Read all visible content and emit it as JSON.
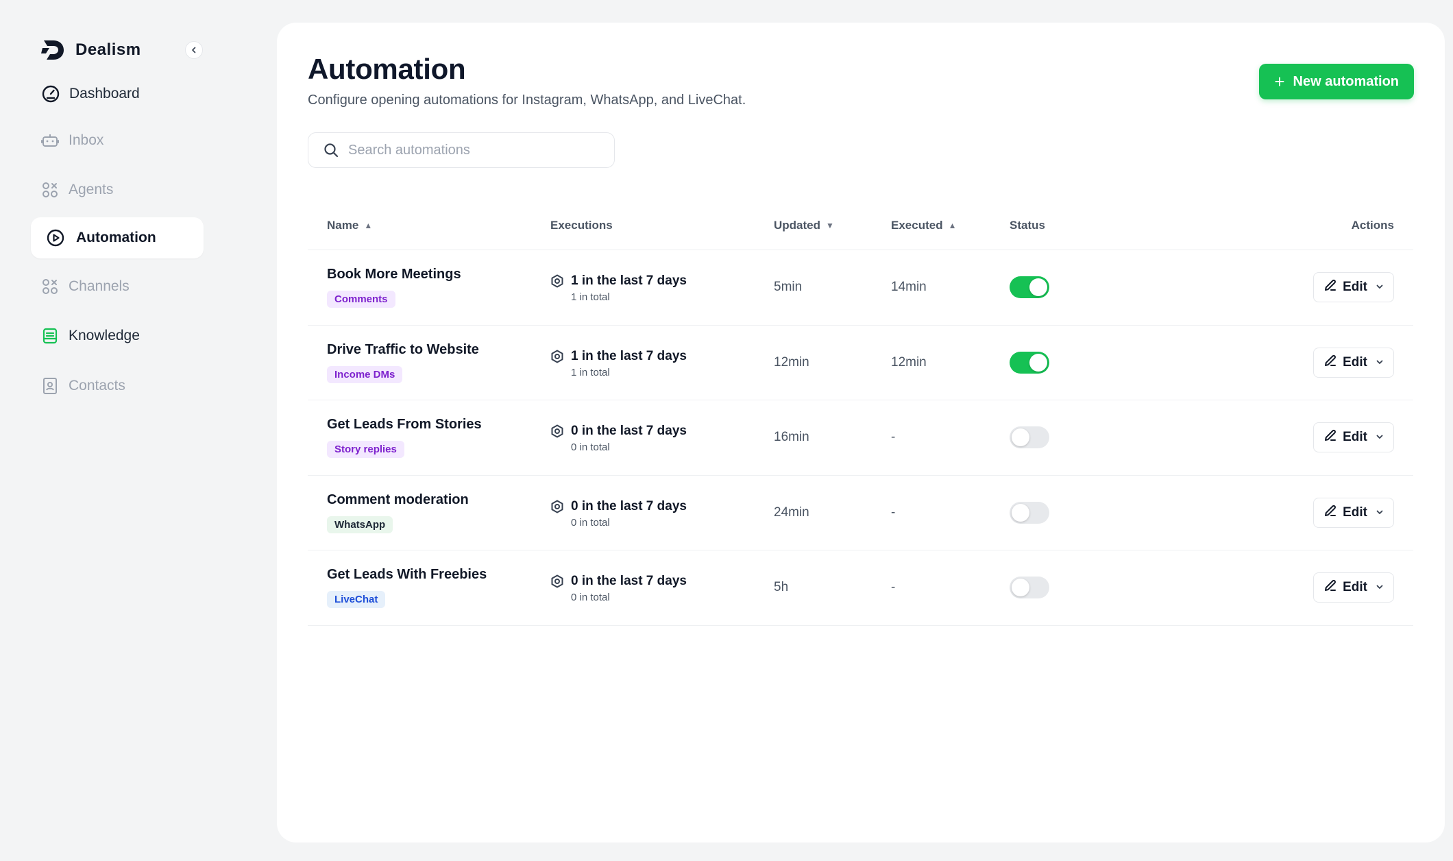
{
  "brand": {
    "name": "Dealism"
  },
  "sidebar": {
    "items": [
      {
        "id": "dashboard",
        "label": "Dashboard",
        "icon": "gauge-icon",
        "state": "dark"
      },
      {
        "id": "inbox",
        "label": "Inbox",
        "icon": "inbox-bot-icon",
        "state": "muted"
      },
      {
        "id": "agents",
        "label": "Agents",
        "icon": "agents-icon",
        "state": "muted"
      },
      {
        "id": "automation",
        "label": "Automation",
        "icon": "play-circle-icon",
        "state": "active"
      },
      {
        "id": "channels",
        "label": "Channels",
        "icon": "channels-icon",
        "state": "muted"
      },
      {
        "id": "knowledge",
        "label": "Knowledge",
        "icon": "knowledge-icon",
        "state": "dark"
      },
      {
        "id": "contacts",
        "label": "Contacts",
        "icon": "contacts-icon",
        "state": "muted"
      }
    ]
  },
  "header": {
    "title": "Automation",
    "subtitle": "Configure opening automations for Instagram, WhatsApp, and LiveChat.",
    "new_button_label": "New automation"
  },
  "search": {
    "placeholder": "Search automations",
    "value": ""
  },
  "table": {
    "columns": {
      "name": "Name",
      "executions": "Executions",
      "updated": "Updated",
      "executed": "Executed",
      "status": "Status",
      "actions": "Actions"
    },
    "rows": [
      {
        "name": "Book More Meetings",
        "tag": "Comments",
        "tag_style": "purple",
        "exec_recent": "1 in the last 7 days",
        "exec_total": "1 in total",
        "updated": "5min",
        "executed": "14min",
        "enabled": true,
        "action_label": "Edit"
      },
      {
        "name": "Drive Traffic to Website",
        "tag": "Income DMs",
        "tag_style": "purple",
        "exec_recent": "1 in the last 7 days",
        "exec_total": "1 in total",
        "updated": "12min",
        "executed": "12min",
        "enabled": true,
        "action_label": "Edit"
      },
      {
        "name": "Get Leads From Stories",
        "tag": "Story replies",
        "tag_style": "purple",
        "exec_recent": "0 in the last 7 days",
        "exec_total": "0 in total",
        "updated": "16min",
        "executed": "-",
        "enabled": false,
        "action_label": "Edit"
      },
      {
        "name": "Comment moderation",
        "tag": "WhatsApp",
        "tag_style": "green",
        "exec_recent": "0 in the last 7 days",
        "exec_total": "0 in total",
        "updated": "24min",
        "executed": "-",
        "enabled": false,
        "action_label": "Edit"
      },
      {
        "name": "Get Leads With Freebies",
        "tag": "LiveChat",
        "tag_style": "blue",
        "exec_recent": "0 in the last 7 days",
        "exec_total": "0 in total",
        "updated": "5h",
        "executed": "-",
        "enabled": false,
        "action_label": "Edit"
      }
    ]
  },
  "colors": {
    "accent": "#16c154",
    "tag_purple_bg": "#f3e8ff",
    "tag_purple_fg": "#7e22ce",
    "tag_green_bg": "#e9f6ec",
    "tag_green_fg": "#1f2937",
    "tag_blue_bg": "#e6f0fb",
    "tag_blue_fg": "#1d4ed8"
  }
}
